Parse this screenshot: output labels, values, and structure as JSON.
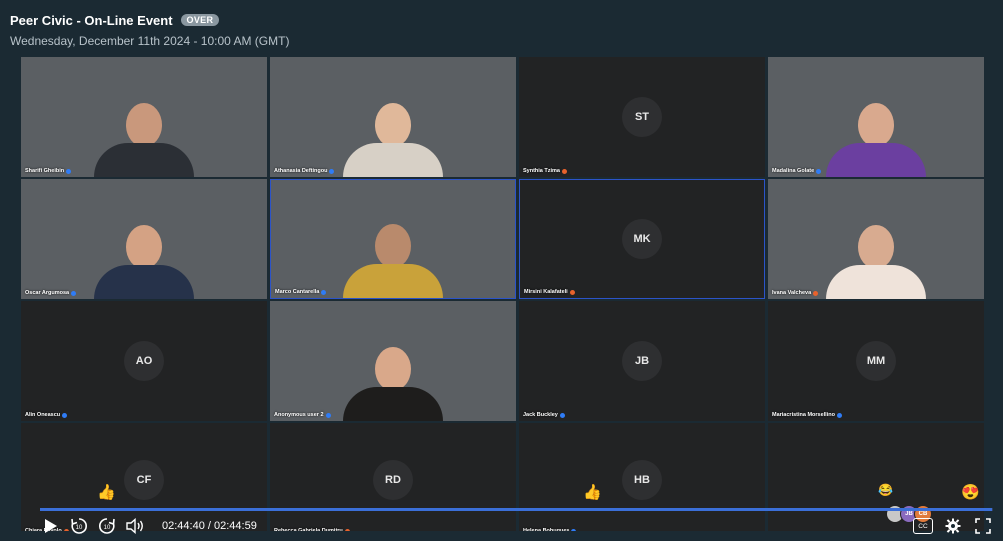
{
  "header": {
    "title": "Peer Civic - On-Line Event",
    "status_badge": "OVER",
    "datetime": "Wednesday, December 11th 2024 - 10:00 AM (GMT)"
  },
  "tiles": [
    {
      "name": "Sharifi Gheibin",
      "initials": "",
      "mode": "video",
      "scene": "office",
      "status": "blue"
    },
    {
      "name": "Athanasia Deftingou",
      "initials": "",
      "mode": "video",
      "scene": "dark",
      "status": "blue"
    },
    {
      "name": "Synthia Tzima",
      "initials": "ST",
      "mode": "avatar",
      "status": "orange"
    },
    {
      "name": "Madalina Golate",
      "initials": "",
      "mode": "video",
      "scene": "shelf",
      "status": "blue"
    },
    {
      "name": "Oscar Argumosa",
      "initials": "",
      "mode": "video",
      "scene": "art",
      "status": "blue"
    },
    {
      "name": "Marco Cantarella",
      "initials": "",
      "mode": "video",
      "scene": "room",
      "status": "blue",
      "active": true
    },
    {
      "name": "Mirsini Kalafateli",
      "initials": "MK",
      "mode": "avatar",
      "status": "orange",
      "active": true
    },
    {
      "name": "Ivana Valcheva",
      "initials": "",
      "mode": "video",
      "scene": "white",
      "status": "orange"
    },
    {
      "name": "Alin Oneascu",
      "initials": "AO",
      "mode": "avatar",
      "status": "blue"
    },
    {
      "name": "Anonymous user 2",
      "initials": "",
      "mode": "video",
      "scene": "marble",
      "status": "blue"
    },
    {
      "name": "Jack Buckley",
      "initials": "JB",
      "mode": "avatar",
      "status": "blue"
    },
    {
      "name": "Mariacristina Morsellino",
      "initials": "MM",
      "mode": "avatar",
      "status": "blue"
    },
    {
      "name": "Chiara Pavolo",
      "initials": "CF",
      "mode": "avatar",
      "status": "orange"
    },
    {
      "name": "Rebecca Gabriela Dumitru",
      "initials": "RD",
      "mode": "avatar",
      "status": "orange"
    },
    {
      "name": "Helena Bohugues",
      "initials": "HB",
      "mode": "avatar",
      "status": "blue"
    },
    {
      "name": "",
      "initials": "",
      "mode": "avatar",
      "status": ""
    }
  ],
  "reactions": {
    "thumbs": "👍",
    "laugh": "😂",
    "heart_eyes": "😍",
    "mini_initials": [
      "JB",
      "CB"
    ]
  },
  "player": {
    "current_time": "02:44:40",
    "separator": " / ",
    "total_time": "02:44:59",
    "progress_fraction": 0.9988,
    "cc_label": "CC",
    "skip_back_label": "10",
    "skip_forward_label": "10"
  },
  "colors": {
    "background": "#1b2a33",
    "tile": "#222324",
    "accent": "#3b6fd8",
    "status_blue": "#2f7cf6",
    "status_orange": "#e8622c"
  }
}
